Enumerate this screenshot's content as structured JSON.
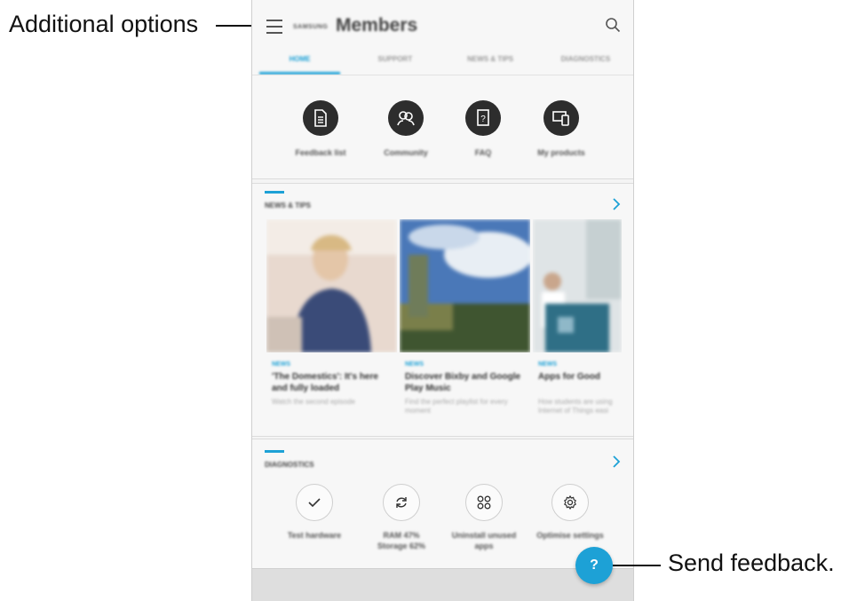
{
  "callouts": {
    "additional_options": "Additional options",
    "send_feedback": "Send feedback."
  },
  "appbar": {
    "brand_small": "SAMSUNG",
    "brand_big": "Members",
    "menu_icon": "hamburger-menu-icon",
    "search_icon": "search-icon"
  },
  "tabs": [
    {
      "label": "HOME",
      "active": true
    },
    {
      "label": "SUPPORT",
      "active": false
    },
    {
      "label": "NEWS & TIPS",
      "active": false
    },
    {
      "label": "DIAGNOSTICS",
      "active": false
    }
  ],
  "quick_actions": [
    {
      "label": "Feedback list",
      "icon": "document-icon"
    },
    {
      "label": "Community",
      "icon": "people-icon"
    },
    {
      "label": "FAQ",
      "icon": "faq-book-icon"
    },
    {
      "label": "My products",
      "icon": "devices-icon"
    }
  ],
  "news": {
    "title": "NEWS & TIPS",
    "cards": [
      {
        "tag": "NEWS",
        "title": "'The Domestics': It's here and fully loaded",
        "subtitle": "Watch the second episode"
      },
      {
        "tag": "NEWS",
        "title": "Discover Bixby and Google Play Music",
        "subtitle": "Find the perfect playlist for every moment"
      },
      {
        "tag": "NEWS",
        "title": "Apps for Good",
        "subtitle": "How students are using Internet of Things easi"
      }
    ]
  },
  "diagnostics": {
    "title": "DIAGNOSTICS",
    "items": [
      {
        "label": "Test hardware",
        "icon": "check-icon"
      },
      {
        "label": "RAM 47%\nStorage 62%",
        "icon": "refresh-icon"
      },
      {
        "label": "Uninstall unused\napps",
        "icon": "apps-grid-icon"
      },
      {
        "label": "Optimise settings",
        "icon": "settings-gear-icon"
      }
    ]
  },
  "fab": {
    "label": "?"
  },
  "colors": {
    "accent": "#1da1d6",
    "icon_dark": "#2d2d2d"
  }
}
